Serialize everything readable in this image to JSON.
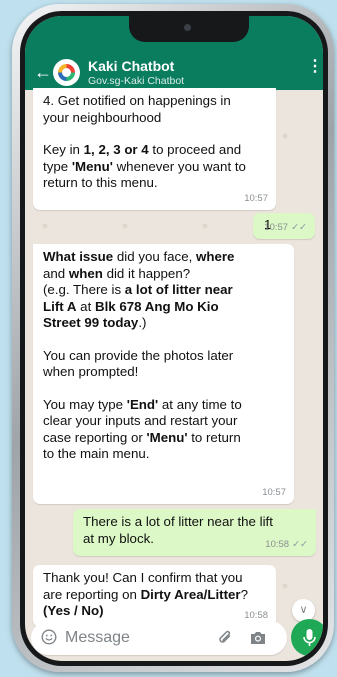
{
  "header": {
    "back_icon": "arrow-left-icon",
    "title": "Kaki Chatbot",
    "subtitle": "Gov.sg-Kaki Chatbot",
    "menu_icon": "more-vert-icon"
  },
  "messages": [
    {
      "direction": "in",
      "lines": [
        "4. Get notified on happenings in",
        "your neighbourhood",
        "",
        "Key in 1, 2, 3 or 4 to proceed and",
        "type 'Menu' whenever you want to",
        "return to this menu."
      ],
      "time": "10:57"
    },
    {
      "direction": "out",
      "text": "1",
      "time": "10:57",
      "status": "read"
    },
    {
      "direction": "in",
      "lines": [
        "What issue did you face, where",
        "and when did it happen?",
        "(e.g. There is a lot of litter near",
        "Lift A at Blk 678 Ang Mo Kio",
        "Street 99 today.)",
        "",
        "You can provide the photos later",
        "when prompted!",
        "",
        "You may type 'End' at any time to",
        "clear your inputs and restart your",
        "case reporting or 'Menu' to return",
        "to the main menu."
      ],
      "time": "10:57"
    },
    {
      "direction": "out",
      "lines": [
        "There is a lot of litter near the lift",
        "at my block."
      ],
      "time": "10:58",
      "status": "read"
    },
    {
      "direction": "in",
      "lines": [
        "Thank you! Can I confirm that you",
        "are reporting on Dirty Area/Litter?",
        "(Yes / No)"
      ],
      "time": "10:58"
    }
  ],
  "input": {
    "placeholder": "Message",
    "emoji_icon": "emoji-icon",
    "attach_icon": "paperclip-icon",
    "camera_icon": "camera-icon",
    "mic_icon": "mic-icon",
    "scroll_icon": "double-chevron-down-icon"
  },
  "colors": {
    "header": "#0a7d5f",
    "outgoing_bubble": "#dcf8c6",
    "incoming_bubble": "#ffffff",
    "mic_button": "#1fa855",
    "chat_background": "#ece5dd"
  }
}
